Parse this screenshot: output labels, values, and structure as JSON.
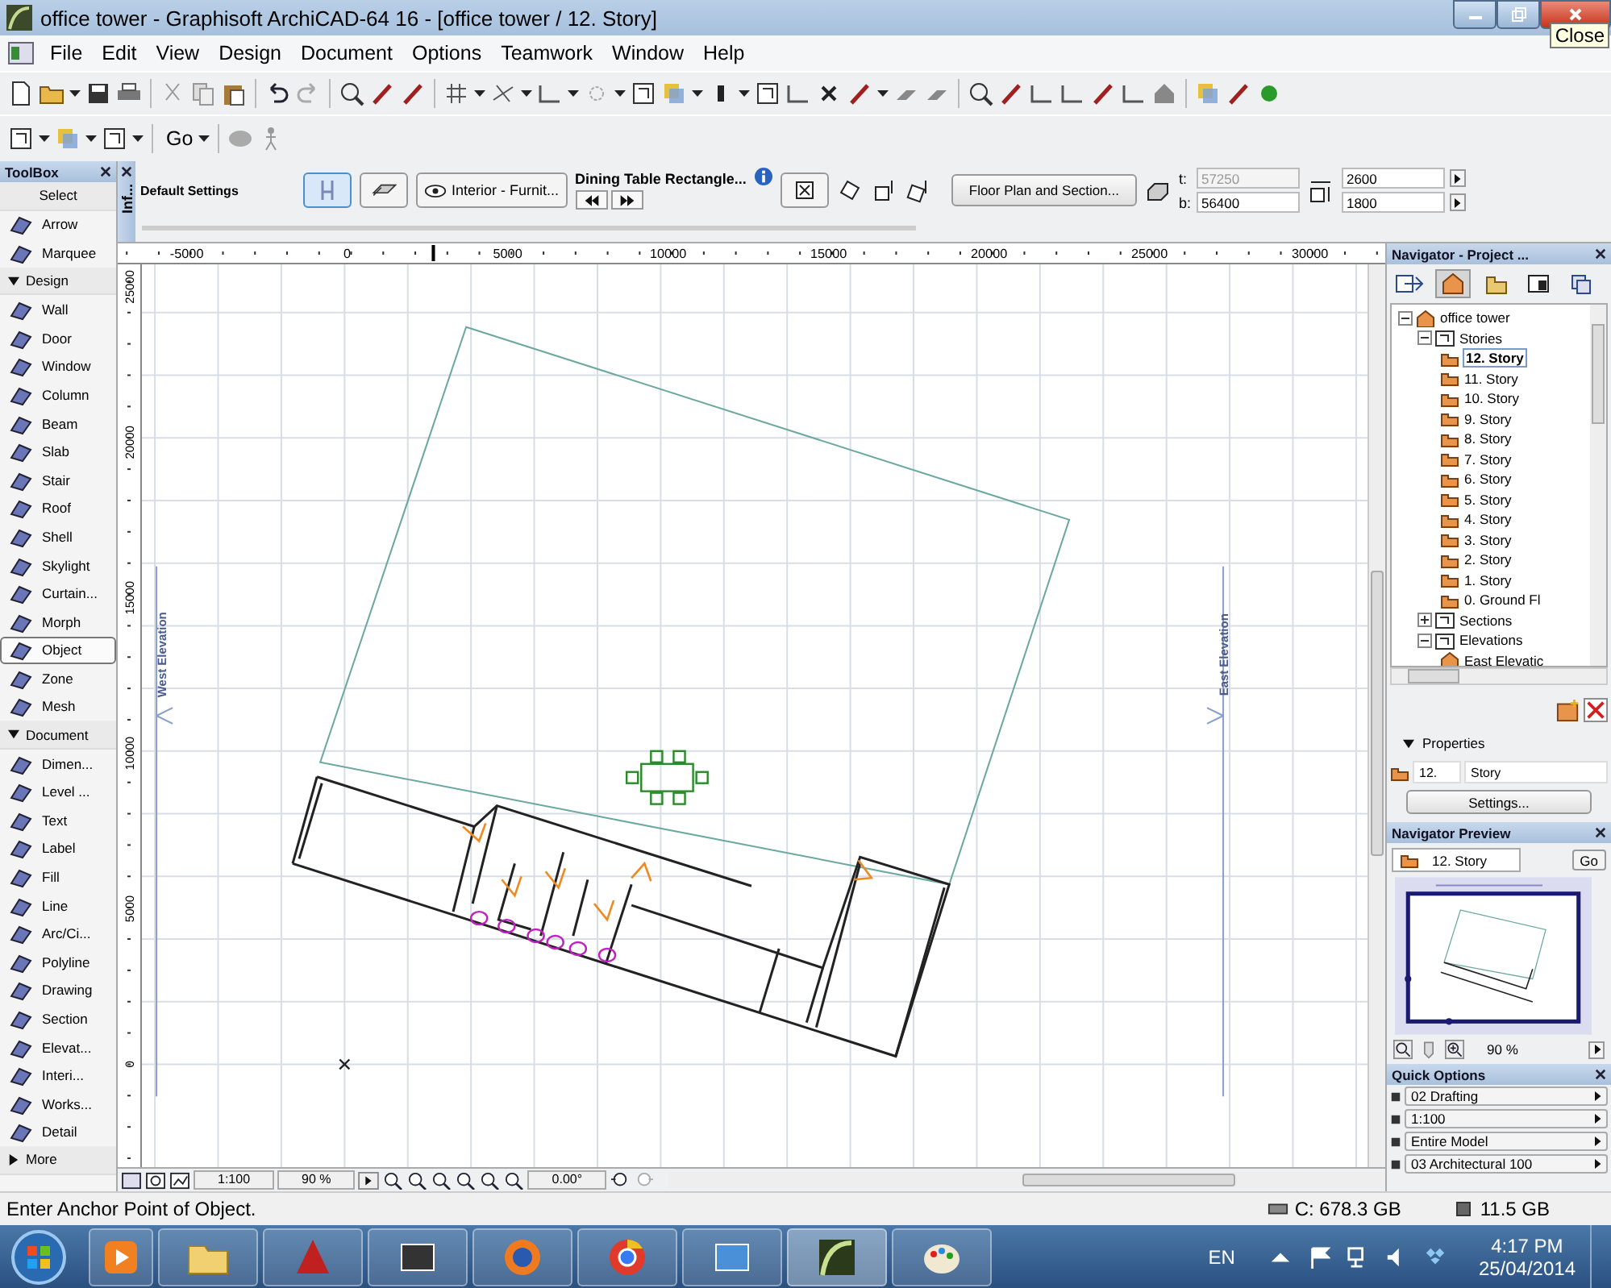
{
  "window": {
    "title": "office tower - Graphisoft ArchiCAD-64 16 - [office tower / 12. Story]",
    "tooltip": "Close"
  },
  "menu": [
    "File",
    "Edit",
    "View",
    "Design",
    "Document",
    "Options",
    "Teamwork",
    "Window",
    "Help"
  ],
  "toolbar": {
    "go_label": "Go"
  },
  "info_box": {
    "tab_label": "Inf...",
    "settings_label": "Default Settings",
    "layer": "Interior - Furnit...",
    "object_name": "Dining Table Rectangle...",
    "view_button": "Floor Plan and Section...",
    "top_label": "t:",
    "top_value": "57250",
    "bottom_label": "b:",
    "bottom_value": "56400",
    "width_value": "2600",
    "depth_value": "1800"
  },
  "toolbox": {
    "title": "ToolBox",
    "sections": [
      {
        "label": "Select",
        "kind": "plain",
        "items": [
          {
            "label": "Arrow",
            "selected": false
          },
          {
            "label": "Marquee",
            "selected": false
          }
        ]
      },
      {
        "label": "Design",
        "kind": "toggle",
        "expanded": true,
        "items": [
          {
            "label": "Wall",
            "selected": false
          },
          {
            "label": "Door",
            "selected": false
          },
          {
            "label": "Window",
            "selected": false
          },
          {
            "label": "Column",
            "selected": false
          },
          {
            "label": "Beam",
            "selected": false
          },
          {
            "label": "Slab",
            "selected": false
          },
          {
            "label": "Stair",
            "selected": false
          },
          {
            "label": "Roof",
            "selected": false
          },
          {
            "label": "Shell",
            "selected": false
          },
          {
            "label": "Skylight",
            "selected": false
          },
          {
            "label": "Curtain...",
            "selected": false
          },
          {
            "label": "Morph",
            "selected": false
          },
          {
            "label": "Object",
            "selected": true
          },
          {
            "label": "Zone",
            "selected": false
          },
          {
            "label": "Mesh",
            "selected": false
          }
        ]
      },
      {
        "label": "Document",
        "kind": "toggle",
        "expanded": true,
        "items": [
          {
            "label": "Dimen...",
            "selected": false
          },
          {
            "label": "Level ...",
            "selected": false
          },
          {
            "label": "Text",
            "selected": false
          },
          {
            "label": "Label",
            "selected": false
          },
          {
            "label": "Fill",
            "selected": false
          },
          {
            "label": "Line",
            "selected": false
          },
          {
            "label": "Arc/Ci...",
            "selected": false
          },
          {
            "label": "Polyline",
            "selected": false
          },
          {
            "label": "Drawing",
            "selected": false
          },
          {
            "label": "Section",
            "selected": false
          },
          {
            "label": "Elevat...",
            "selected": false
          },
          {
            "label": "Interi...",
            "selected": false
          },
          {
            "label": "Works...",
            "selected": false
          },
          {
            "label": "Detail",
            "selected": false
          }
        ]
      },
      {
        "label": "More",
        "kind": "toggle",
        "expanded": false
      }
    ]
  },
  "canvas": {
    "x_ruler": [
      "-5000",
      "0",
      "5000",
      "10000",
      "15000",
      "20000",
      "25000",
      "30000"
    ],
    "y_ruler": [
      "25000",
      "20000",
      "15000",
      "10000",
      "5000",
      "0"
    ],
    "west_label": "West Elevation",
    "east_label": "East Elevation",
    "scale": "1:100",
    "zoom": "90 %",
    "angle": "0.00°"
  },
  "navigator": {
    "title": "Navigator - Project ...",
    "tree": [
      {
        "label": "office tower",
        "kind": "project",
        "expanded": true,
        "selected": false,
        "children": [
          {
            "label": "Stories",
            "kind": "group",
            "expanded": true,
            "selected": false,
            "children": [
              {
                "label": "12. Story",
                "kind": "story",
                "selected": true
              },
              {
                "label": "11. Story",
                "kind": "story",
                "selected": false
              },
              {
                "label": "10. Story",
                "kind": "story",
                "selected": false
              },
              {
                "label": "9. Story",
                "kind": "story",
                "selected": false
              },
              {
                "label": "8. Story",
                "kind": "story",
                "selected": false
              },
              {
                "label": "7. Story",
                "kind": "story",
                "selected": false
              },
              {
                "label": "6. Story",
                "kind": "story",
                "selected": false
              },
              {
                "label": "5. Story",
                "kind": "story",
                "selected": false
              },
              {
                "label": "4. Story",
                "kind": "story",
                "selected": false
              },
              {
                "label": "3. Story",
                "kind": "story",
                "selected": false
              },
              {
                "label": "2. Story",
                "kind": "story",
                "selected": false
              },
              {
                "label": "1. Story",
                "kind": "story",
                "selected": false
              },
              {
                "label": "0. Ground Fl",
                "kind": "story",
                "selected": false
              }
            ]
          },
          {
            "label": "Sections",
            "kind": "group",
            "expanded": false,
            "selected": false
          },
          {
            "label": "Elevations",
            "kind": "group",
            "expanded": true,
            "selected": false,
            "children": [
              {
                "label": "East Elevatic",
                "kind": "view",
                "selected": false
              }
            ]
          }
        ]
      }
    ],
    "properties_label": "Properties",
    "story_number": "12.",
    "story_name": "Story",
    "settings_button": "Settings..."
  },
  "preview": {
    "title": "Navigator Preview",
    "story": "12. Story",
    "go_button": "Go",
    "zoom": "90 %"
  },
  "quick_options": {
    "title": "Quick Options",
    "options": [
      "02 Drafting",
      "1:100",
      "Entire Model",
      "03 Architectural 100"
    ]
  },
  "status_bar": {
    "message": "Enter Anchor Point of Object.",
    "disk_c": "C: 678.3 GB",
    "disk_2": "11.5 GB"
  },
  "taskbar": {
    "language": "EN",
    "time": "4:17 PM",
    "date": "25/04/2014"
  }
}
